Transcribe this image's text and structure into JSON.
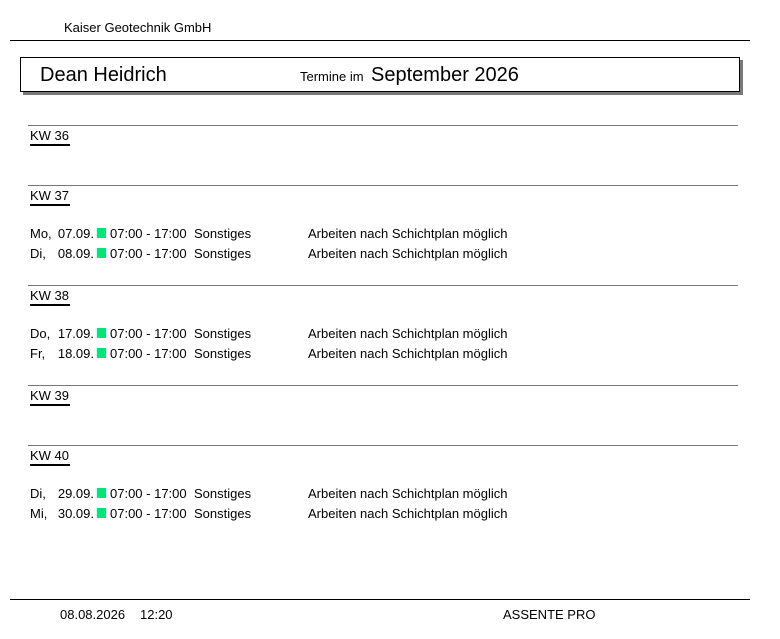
{
  "company": "Kaiser Geotechnik GmbH",
  "header": {
    "employee_name": "Dean Heidrich",
    "month_prefix": "Termine im",
    "month_name": "September 2026"
  },
  "weeks": [
    {
      "label": "KW 36",
      "entries": []
    },
    {
      "label": "KW 37",
      "entries": [
        {
          "day": "Mo,",
          "date": "07.09.",
          "time": "07:00 - 17:00",
          "type": "Sonstiges",
          "note": "Arbeiten nach Schichtplan möglich",
          "marker_color": "#00e676"
        },
        {
          "day": "Di,",
          "date": "08.09.",
          "time": "07:00 - 17:00",
          "type": "Sonstiges",
          "note": "Arbeiten nach Schichtplan möglich",
          "marker_color": "#00e676"
        }
      ]
    },
    {
      "label": "KW 38",
      "entries": [
        {
          "day": "Do,",
          "date": "17.09.",
          "time": "07:00 - 17:00",
          "type": "Sonstiges",
          "note": "Arbeiten nach Schichtplan möglich",
          "marker_color": "#00e676"
        },
        {
          "day": "Fr,",
          "date": "18.09.",
          "time": "07:00 - 17:00",
          "type": "Sonstiges",
          "note": "Arbeiten nach Schichtplan möglich",
          "marker_color": "#00e676"
        }
      ]
    },
    {
      "label": "KW 39",
      "entries": []
    },
    {
      "label": "KW 40",
      "entries": [
        {
          "day": "Di,",
          "date": "29.09.",
          "time": "07:00 - 17:00",
          "type": "Sonstiges",
          "note": "Arbeiten nach Schichtplan möglich",
          "marker_color": "#00e676"
        },
        {
          "day": "Mi,",
          "date": "30.09.",
          "time": "07:00 - 17:00",
          "type": "Sonstiges",
          "note": "Arbeiten nach Schichtplan möglich",
          "marker_color": "#00e676"
        }
      ]
    }
  ],
  "footer": {
    "date": "08.08.2026",
    "time": "12:20",
    "app": "ASSENTE PRO"
  }
}
